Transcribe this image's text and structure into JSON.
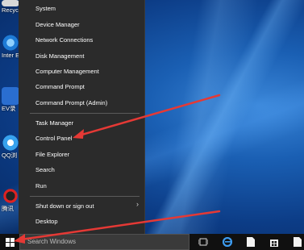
{
  "desktop": {
    "icons": [
      {
        "label": "Recycl",
        "color": "#d8d8d8"
      },
      {
        "label": "Inter Explo",
        "color": "#1e7bd6"
      },
      {
        "label": "EV录",
        "color": "#2a6ed0"
      },
      {
        "label": "QQ浏",
        "color": "#37a2ee"
      },
      {
        "label": "腾讯",
        "color": "#d22"
      }
    ]
  },
  "menu": {
    "items": [
      "System",
      "Device Manager",
      "Network Connections",
      "Disk Management",
      "Computer Management",
      "Command Prompt",
      "Command Prompt (Admin)",
      "Task Manager",
      "Control Panel",
      "File Explorer",
      "Search",
      "Run",
      "Shut down or sign out",
      "Desktop"
    ],
    "submenu_glyph": "›"
  },
  "taskbar": {
    "search_placeholder": "Search Windows",
    "icons": [
      "task-view-icon",
      "edge-icon",
      "document-icon",
      "store-icon",
      "document-icon"
    ]
  },
  "colors": {
    "accent": "#e53935",
    "menu_bg": "#2b2b2b",
    "taskbar_bg": "#101010"
  }
}
